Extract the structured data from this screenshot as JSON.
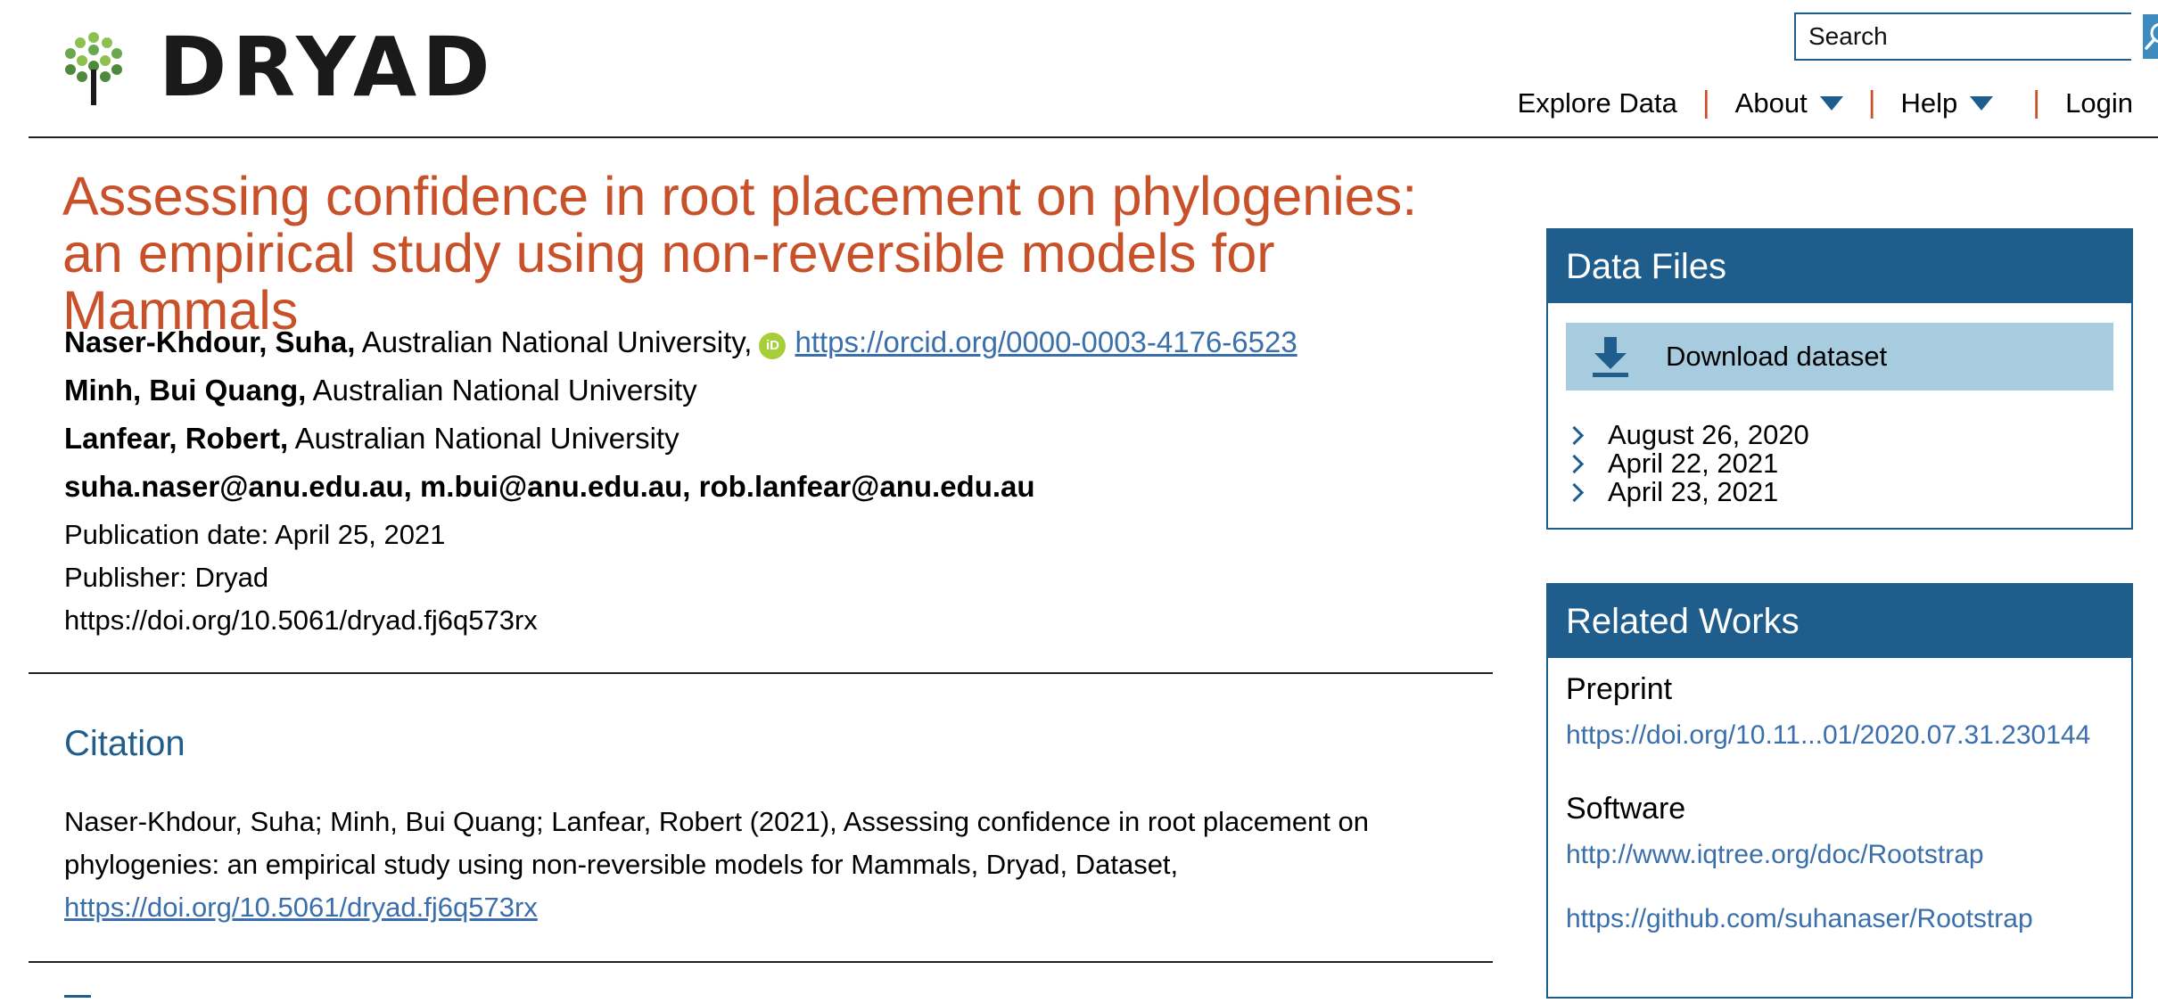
{
  "header": {
    "logo_text": "DRYAD",
    "search_placeholder": "Search",
    "nav": {
      "explore": "Explore Data",
      "about": "About",
      "help": "Help",
      "login": "Login",
      "separator": "|"
    }
  },
  "dataset": {
    "title": "Assessing confidence in root placement on phylogenies: an empirical study using non-reversible models for Mammals",
    "authors": [
      {
        "name": "Naser-Khdour, Suha,",
        "affiliation": " Australian National University,",
        "orcid_badge": "iD",
        "orcid": "https://orcid.org/0000-0003-4176-6523"
      },
      {
        "name": "Minh, Bui Quang,",
        "affiliation": " Australian National University"
      },
      {
        "name": "Lanfear, Robert,",
        "affiliation": " Australian National University"
      }
    ],
    "emails": "suha.naser@anu.edu.au, m.bui@anu.edu.au, rob.lanfear@anu.edu.au",
    "publication_date": "Publication date: April 25, 2021",
    "publisher": "Publisher: Dryad",
    "doi": "https://doi.org/10.5061/dryad.fj6q573rx"
  },
  "citation": {
    "heading": "Citation",
    "text": "Naser-Khdour, Suha; Minh, Bui Quang; Lanfear, Robert (2021), Assessing confidence in root placement on phylogenies: an empirical study using non-reversible models for Mammals, Dryad, Dataset,",
    "link": "https://doi.org/10.5061/dryad.fj6q573rx"
  },
  "sidebar": {
    "data_files": {
      "heading": "Data Files",
      "download_label": "Download dataset",
      "versions": [
        "August 26, 2020",
        "April 22, 2021",
        "April 23, 2021"
      ]
    },
    "related_works": {
      "heading": "Related Works",
      "preprint_label": "Preprint",
      "preprint_link": "https://doi.org/10.11...01/2020.07.31.230144",
      "software_label": "Software",
      "software_links": [
        "http://www.iqtree.org/doc/Rootstrap",
        "https://github.com/suhanaser/Rootstrap"
      ]
    }
  },
  "colors": {
    "accent_orange": "#c9512a",
    "brand_blue": "#1f5e8c",
    "link_blue": "#3a6fab",
    "orcid_green": "#a6ce39",
    "download_bg": "#a7cce0"
  },
  "icons": [
    "tree-logo-icon",
    "search-icon",
    "orcid-icon",
    "download-icon",
    "chevron-right-icon",
    "triangle-down-icon"
  ]
}
